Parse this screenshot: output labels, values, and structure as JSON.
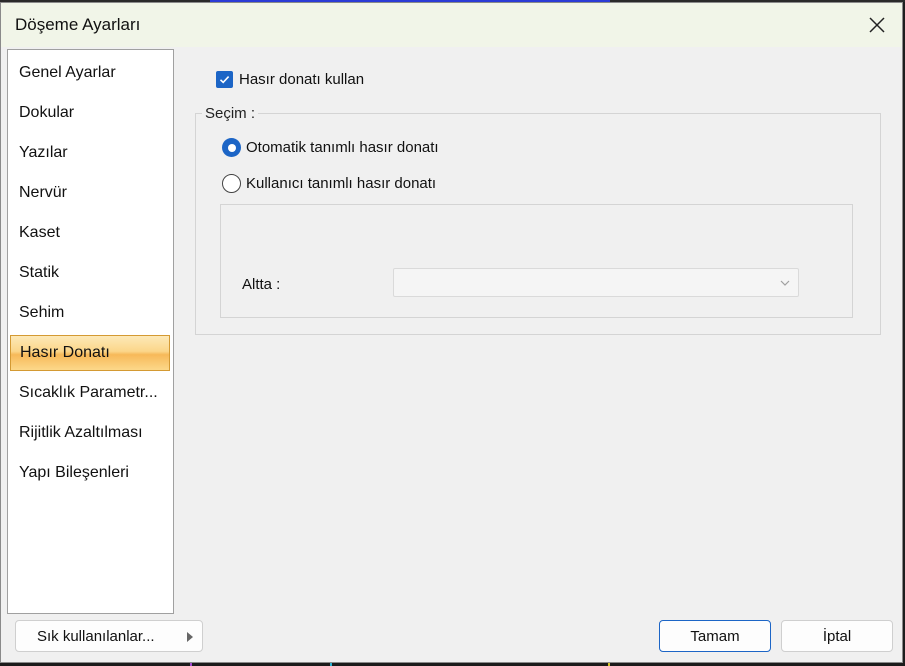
{
  "window": {
    "title": "Döşeme Ayarları"
  },
  "sidebar": {
    "items": [
      {
        "label": "Genel Ayarlar"
      },
      {
        "label": "Dokular"
      },
      {
        "label": "Yazılar"
      },
      {
        "label": "Nervür"
      },
      {
        "label": "Kaset"
      },
      {
        "label": "Statik"
      },
      {
        "label": "Sehim"
      },
      {
        "label": "Hasır Donatı",
        "selected": true
      },
      {
        "label": "Sıcaklık Parametr..."
      },
      {
        "label": "Rijitlik Azaltılması"
      },
      {
        "label": "Yapı Bileşenleri"
      }
    ]
  },
  "main": {
    "use_mesh_checkbox": {
      "label": "Hasır donatı kullan",
      "checked": true
    },
    "selection_group": {
      "legend": "Seçim :",
      "options": [
        {
          "label": "Otomatik tanımlı hasır donatı",
          "selected": true
        },
        {
          "label": "Kullanıcı tanımlı hasır donatı",
          "selected": false
        }
      ],
      "bottom_field": {
        "label": "Altta :",
        "value": "",
        "enabled": false
      }
    }
  },
  "footer": {
    "favorites_label": "Sık kullanılanlar...",
    "ok_label": "Tamam",
    "cancel_label": "İptal"
  },
  "colors": {
    "accent": "#1c65c6",
    "selection": "#fbd68a"
  }
}
